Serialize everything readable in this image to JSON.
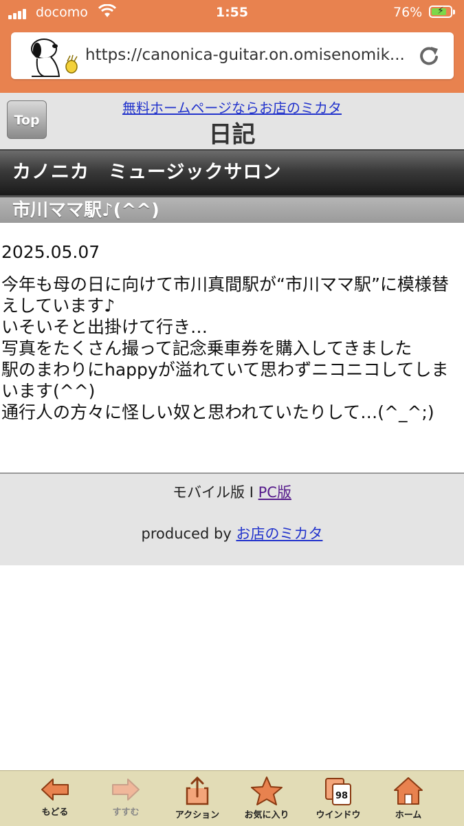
{
  "status_bar": {
    "carrier": "docomo",
    "time": "1:55",
    "battery_percent": "76%",
    "battery_level": 0.76,
    "battery_color": "#7cd84a"
  },
  "browser": {
    "url": "https://canonica-guitar.on.omisenomik...",
    "reload_icon": "reload-icon",
    "accent_color": "#e8824f"
  },
  "site": {
    "top_button": "Top",
    "ad_link": "無料ホームページならお店のミカタ",
    "page_title": "日記",
    "shop_name": "カノニカ　ミュージックサロン",
    "entry_title": "市川ママ駅♪(^^)"
  },
  "entry": {
    "date": "2025.05.07",
    "body": "今年も母の日に向けて市川真間駅が“市川ママ駅”に模様替えしています♪\nいそいそと出掛けて行き…\n写真をたくさん撮って記念乗車券を購入してきました\n駅のまわりにhappyが溢れていて思わずニコニコしてしまいます(^^)\n通行人の方々に怪しい奴と思われていたりして…(^_^;)"
  },
  "footer": {
    "mobile_label": "モバイル版",
    "separator": "I",
    "pc_link": "PC版",
    "produced_by": "produced by",
    "produced_link": "お店のミカタ"
  },
  "toolbar": {
    "back": "もどる",
    "forward": "すすむ",
    "action": "アクション",
    "favorites": "お気に入り",
    "windows": "ウインドウ",
    "window_count": "98",
    "home": "ホーム"
  }
}
